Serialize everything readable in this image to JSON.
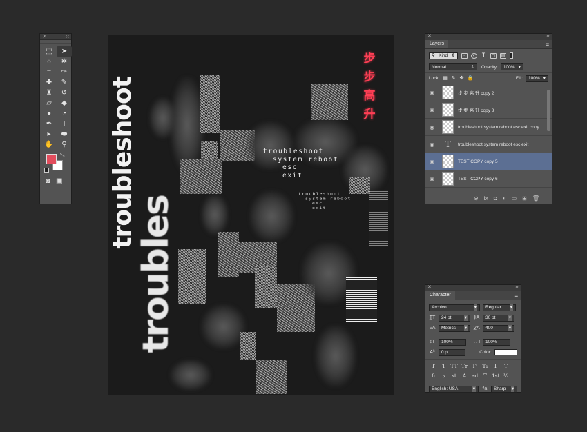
{
  "tools_panel": {
    "close_glyph": "✕",
    "collapse_glyph": "‹‹",
    "tools": [
      {
        "name": "marquee-tool-icon",
        "glyph": "⬚",
        "active": false
      },
      {
        "name": "move-tool-icon",
        "glyph": "➤",
        "active": true
      },
      {
        "name": "lasso-tool-icon",
        "glyph": "◌",
        "active": false
      },
      {
        "name": "magic-wand-tool-icon",
        "glyph": "✲",
        "active": false
      },
      {
        "name": "crop-tool-icon",
        "glyph": "⌗",
        "active": false
      },
      {
        "name": "eyedropper-tool-icon",
        "glyph": "✑",
        "active": false
      },
      {
        "name": "healing-brush-tool-icon",
        "glyph": "✚",
        "active": false
      },
      {
        "name": "brush-tool-icon",
        "glyph": "✎",
        "active": false
      },
      {
        "name": "clone-stamp-tool-icon",
        "glyph": "♜",
        "active": false
      },
      {
        "name": "history-brush-tool-icon",
        "glyph": "↺",
        "active": false
      },
      {
        "name": "eraser-tool-icon",
        "glyph": "▱",
        "active": false
      },
      {
        "name": "paint-bucket-tool-icon",
        "glyph": "◆",
        "active": false
      },
      {
        "name": "blur-tool-icon",
        "glyph": "●",
        "active": false
      },
      {
        "name": "dodge-tool-icon",
        "glyph": "◔",
        "active": false
      },
      {
        "name": "pen-tool-icon",
        "glyph": "✒",
        "active": false
      },
      {
        "name": "type-tool-icon",
        "glyph": "T",
        "active": false
      },
      {
        "name": "path-selection-tool-icon",
        "glyph": "▸",
        "active": false
      },
      {
        "name": "shape-tool-icon",
        "glyph": "⬬",
        "active": false
      },
      {
        "name": "hand-tool-icon",
        "glyph": "✋",
        "active": false
      },
      {
        "name": "zoom-tool-icon",
        "glyph": "⚲",
        "active": false
      }
    ],
    "foreground_color": "#e24d5d",
    "background_color": "#ffffff",
    "quick_mask_glyph": "◙",
    "screen_mode_glyph": "▣"
  },
  "canvas": {
    "vertical_text_small": "troubleshoot",
    "vertical_text_large": "troubles",
    "cjk_text": [
      "步",
      "步",
      "高",
      "升"
    ],
    "text_block_1": [
      "troubleshoot",
      "system reboot",
      "esc",
      "exit"
    ],
    "text_block_2": [
      "troubleshoot",
      "system reboot",
      "esc",
      "exit"
    ]
  },
  "layers_panel": {
    "title": "Layers",
    "close_glyph": "✕",
    "collapse_glyph": "‹‹",
    "menu_glyph": "≡",
    "filter_label": "Kind",
    "blend_mode": "Normal",
    "opacity_label": "Opacity:",
    "opacity_value": "100%",
    "lock_label": "Lock:",
    "fill_label": "Fill:",
    "fill_value": "100%",
    "layers": [
      {
        "name": "步 步 高 升 copy 2",
        "type": "raster",
        "selected": false
      },
      {
        "name": "步 步 高 升 copy 3",
        "type": "raster",
        "selected": false
      },
      {
        "name": "troubleshoot system reboot esc exit  copy",
        "type": "raster",
        "selected": false
      },
      {
        "name": "troubleshoot system reboot esc exit",
        "type": "text",
        "selected": false
      },
      {
        "name": "TEST COPY copy 5",
        "type": "raster",
        "selected": true
      },
      {
        "name": "TEST COPY copy 6",
        "type": "raster",
        "selected": false
      }
    ],
    "footer_icons": [
      "⊝",
      "fx",
      "◘",
      "◐",
      "▭",
      "⊞",
      "🗑"
    ]
  },
  "character_panel": {
    "title": "Character",
    "close_glyph": "✕",
    "collapse_glyph": "‹‹",
    "menu_glyph": "≡",
    "font_family": "Archivo",
    "font_style": "Regular",
    "font_size": "24 pt",
    "leading": "30 pt",
    "kerning": "Metrics",
    "tracking": "400",
    "vertical_scale": "100%",
    "horizontal_scale": "100%",
    "baseline_shift": "0 pt",
    "color_label": "Color:",
    "color_value": "#ffffff",
    "formatting_buttons": [
      "T",
      "T",
      "TT",
      "Tт",
      "T¹",
      "T₁",
      "T",
      "Ŧ"
    ],
    "opentype_buttons": [
      "fi",
      "ℴ",
      "st",
      "A",
      "ad",
      "T",
      "1st",
      "½"
    ],
    "language": "English: USA",
    "antialias_label": "ªa",
    "antialias": "Sharp"
  }
}
